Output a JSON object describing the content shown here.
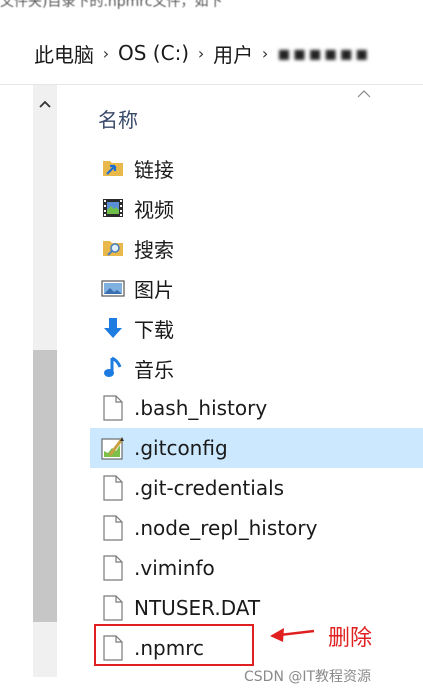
{
  "caption": {
    "text": "文件夹)目录下的.npmrc文件，如下"
  },
  "address_bar": {
    "crumbs": [
      "此电脑",
      "OS (C:)",
      "用户",
      "▪▪▪▪▪▪"
    ],
    "separator": "›"
  },
  "list": {
    "header": "名称",
    "items": [
      {
        "name": "链接",
        "icon": "shortcut-folder-icon"
      },
      {
        "name": "视频",
        "icon": "video-folder-icon"
      },
      {
        "name": "搜索",
        "icon": "search-folder-icon"
      },
      {
        "name": "图片",
        "icon": "pictures-folder-icon"
      },
      {
        "name": "下载",
        "icon": "download-arrow-icon"
      },
      {
        "name": "音乐",
        "icon": "music-note-icon"
      },
      {
        "name": ".bash_history",
        "icon": "file-icon"
      },
      {
        "name": ".gitconfig",
        "icon": "gitconfig-file-icon"
      },
      {
        "name": ".git-credentials",
        "icon": "file-icon"
      },
      {
        "name": ".node_repl_history",
        "icon": "file-icon"
      },
      {
        "name": ".viminfo",
        "icon": "file-icon"
      },
      {
        "name": "NTUSER.DAT",
        "icon": "file-icon"
      },
      {
        "name": ".npmrc",
        "icon": "file-icon"
      }
    ]
  },
  "annotation": {
    "label": "删除",
    "color": "#e02020"
  },
  "watermark": {
    "text": "CSDN @IT教程资源"
  },
  "colors": {
    "folder_yellow": "#e8b84a",
    "download_blue": "#1e7be0",
    "selection": "#cce8ff"
  }
}
